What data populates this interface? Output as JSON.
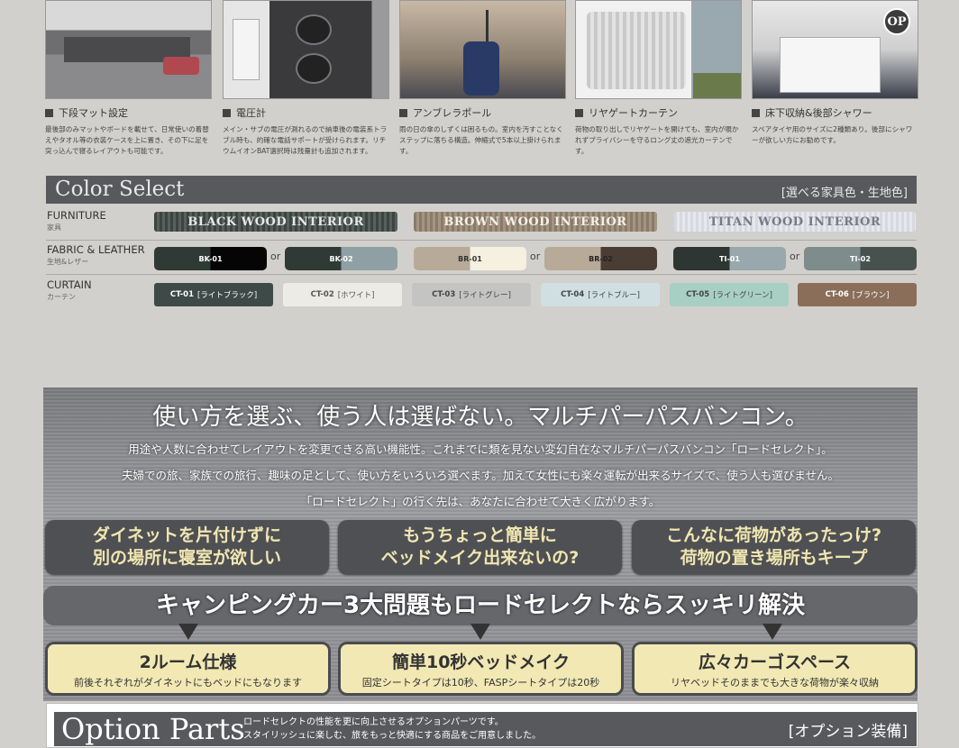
{
  "features": [
    {
      "title": "下段マット設定",
      "desc": "最後部のみマットやボードを載せて、日常使いの着替えやタオル等の衣装ケースを上に置き、その下に足を突っ込んで寝るレイアウトも可能です。"
    },
    {
      "title": "電圧計",
      "desc": "メイン・サブの電圧が測れるので納車後の電装系トラブル時も、的確な電話サポートが受けられます。リチウムイオンBAT選択時は残量計も追加されます。"
    },
    {
      "title": "アンブレラポール",
      "desc": "雨の日の傘のしずくは困るもの。室内を汚すことなくステップに落ちる構造。伸縮式で5本以上掛けられます。"
    },
    {
      "title": "リヤゲートカーテン",
      "desc": "荷物の取り出しでリヤゲートを開けても、室内が覗かれずプライバシーを守るロング丈の遮光カーテンです。"
    },
    {
      "title": "床下収納&後部シャワー",
      "desc": "スペアタイヤ用のサイズに2種類あり。後部にシャワーが欲しい方にお勧めです。",
      "badge": "OP"
    }
  ],
  "color_select": {
    "title": "Color Select",
    "subtitle": "[選べる家具色・生地色]",
    "rows": {
      "furniture": {
        "label": "FURNITURE",
        "sub": "家具"
      },
      "fabric": {
        "label": "FABRIC & LEATHER",
        "sub": "生地&レザー"
      },
      "curtain": {
        "label": "CURTAIN",
        "sub": "カーテン"
      }
    },
    "woods": [
      "BLACK WOOD INTERIOR",
      "BROWN WOOD INTERIOR",
      "TITAN WOOD INTERIOR"
    ],
    "swatches": [
      "BK-01",
      "BK-02",
      "BR-01",
      "BR-02",
      "TI-01",
      "TI-02"
    ],
    "or": "or",
    "curtains": [
      {
        "code": "CT-01",
        "name": "[ライトブラック]"
      },
      {
        "code": "CT-02",
        "name": "[ホワイト]"
      },
      {
        "code": "CT-03",
        "name": "[ライトグレー]"
      },
      {
        "code": "CT-04",
        "name": "[ライトブルー]"
      },
      {
        "code": "CT-05",
        "name": "[ライトグリーン]"
      },
      {
        "code": "CT-06",
        "name": "[ブラウン]"
      }
    ]
  },
  "hero": {
    "headline": "使い方を選ぶ、使う人は選ばない。マルチパーパスバンコン。",
    "lines": [
      "用途や人数に合わせてレイアウトを変更できる高い機能性。これまでに類を見ない変幻自在なマルチパーパスバンコン「ロードセレクト」。",
      "夫婦での旅、家族での旅行、趣味の足として、使い方をいろいろ選べます。加えて女性にも楽々運転が出来るサイズで、使う人も選びません。",
      "「ロードセレクト」の行く先は、あなたに合わせて大きく広がります。"
    ],
    "questions": [
      {
        "l1": "ダイネットを片付けずに",
        "l2": "別の場所に寝室が欲しい"
      },
      {
        "l1": "もうちょっと簡単に",
        "l2": "ベッドメイク出来ないの?"
      },
      {
        "l1": "こんなに荷物があったっけ?",
        "l2": "荷物の置き場所もキープ"
      }
    ],
    "banner": "キャンピングカー3大問題もロードセレクトならスッキリ解決",
    "answers": [
      {
        "title": "2ルーム仕様",
        "desc": "前後それぞれがダイネットにもベッドにもなります"
      },
      {
        "title": "簡単10秒ベッドメイク",
        "desc": "固定シートタイプは10秒、FASPシートタイプは20秒"
      },
      {
        "title": "広々カーゴスペース",
        "desc": "リヤベッドそのままでも大きな荷物が楽々収納"
      }
    ]
  },
  "option": {
    "title": "Option Parts",
    "desc1": "ロードセレクトの性能を更に向上させるオプションパーツです。",
    "desc2": "スタイリッシュに楽しむ、旅をもっと快適にする商品をご用意しました。",
    "right": "[オプション装備]"
  },
  "colors": {
    "bar": "#58595d",
    "answer_bg": "#f1e8b4",
    "question_text": "#f0e6b0"
  }
}
